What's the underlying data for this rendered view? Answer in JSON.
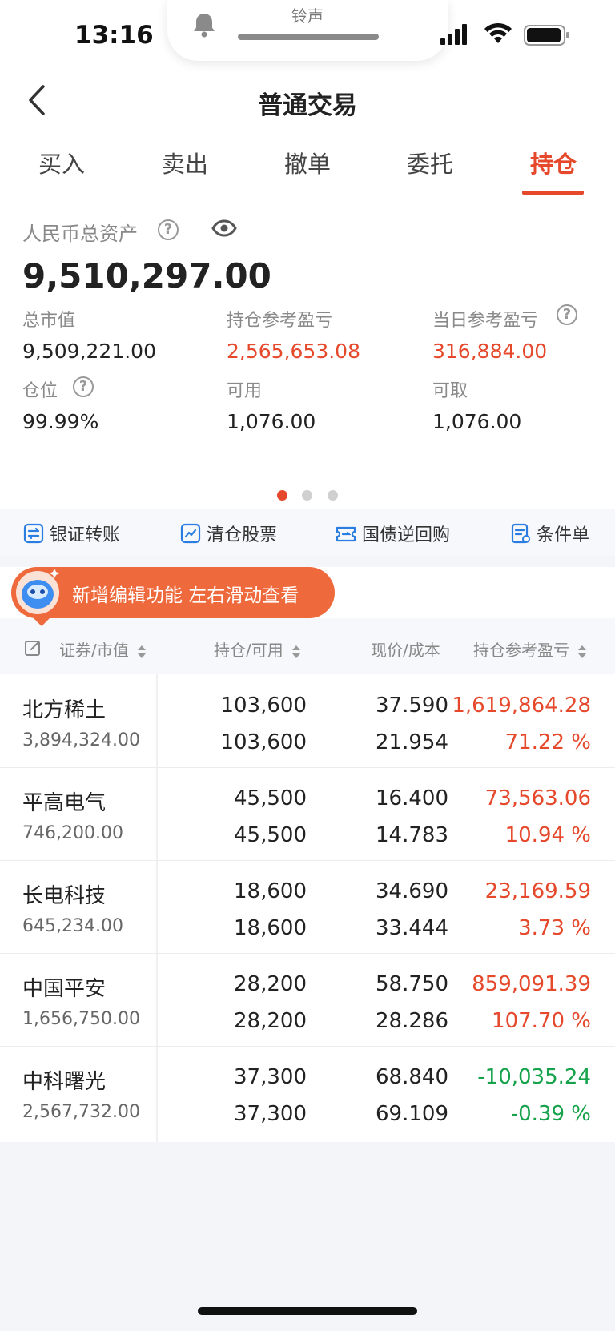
{
  "status": {
    "time": "13:16",
    "ringer_label": "铃声"
  },
  "nav": {
    "title": "普通交易"
  },
  "tabs": [
    {
      "label": "买入"
    },
    {
      "label": "卖出"
    },
    {
      "label": "撤单"
    },
    {
      "label": "委托"
    },
    {
      "label": "持仓",
      "active": true
    }
  ],
  "assets": {
    "total_label": "人民币总资产",
    "total_value": "9,510,297.00",
    "market_value_label": "总市值",
    "market_value": "9,509,221.00",
    "position_pl_label": "持仓参考盈亏",
    "position_pl": "2,565,653.08",
    "daily_pl_label": "当日参考盈亏",
    "daily_pl": "316,884.00",
    "ratio_label": "仓位",
    "ratio": "99.99%",
    "available_label": "可用",
    "available": "1,076.00",
    "withdrawable_label": "可取",
    "withdrawable": "1,076.00",
    "page_dots_count": 3,
    "page_dots_active": 0
  },
  "shortcuts": [
    {
      "label": "银证转账",
      "icon": "transfer-icon"
    },
    {
      "label": "清仓股票",
      "icon": "clear-chart-icon"
    },
    {
      "label": "国债逆回购",
      "icon": "repo-ticket-icon"
    },
    {
      "label": "条件单",
      "icon": "condition-order-icon"
    }
  ],
  "banner": {
    "text": "新增编辑功能 左右滑动查看"
  },
  "table": {
    "headers": {
      "security": "证券/市值",
      "position": "持仓/可用",
      "price": "现价/成本",
      "pl": "持仓参考盈亏"
    },
    "rows": [
      {
        "name": "北方稀土",
        "market_value": "3,894,324.00",
        "position": "103,600",
        "available": "103,600",
        "price": "37.590",
        "cost": "21.954",
        "pl": "1,619,864.28",
        "pl_pct": "71.22 %",
        "direction": "up"
      },
      {
        "name": "平高电气",
        "market_value": "746,200.00",
        "position": "45,500",
        "available": "45,500",
        "price": "16.400",
        "cost": "14.783",
        "pl": "73,563.06",
        "pl_pct": "10.94 %",
        "direction": "up"
      },
      {
        "name": "长电科技",
        "market_value": "645,234.00",
        "position": "18,600",
        "available": "18,600",
        "price": "34.690",
        "cost": "33.444",
        "pl": "23,169.59",
        "pl_pct": "3.73 %",
        "direction": "up"
      },
      {
        "name": "中国平安",
        "market_value": "1,656,750.00",
        "position": "28,200",
        "available": "28,200",
        "price": "58.750",
        "cost": "28.286",
        "pl": "859,091.39",
        "pl_pct": "107.70 %",
        "direction": "up"
      },
      {
        "name": "中科曙光",
        "market_value": "2,567,732.00",
        "position": "37,300",
        "available": "37,300",
        "price": "68.840",
        "cost": "69.109",
        "pl": "-10,035.24",
        "pl_pct": "-0.39 %",
        "direction": "down"
      }
    ]
  },
  "colors": {
    "accent": "#e5482b",
    "up": "#e5482b",
    "down": "#15a24a",
    "banner": "#ee6a3c"
  }
}
